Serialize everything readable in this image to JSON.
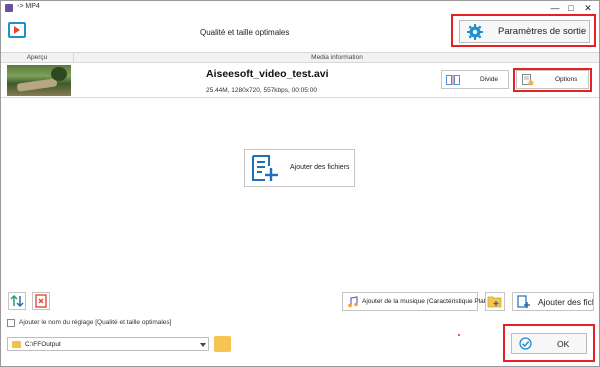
{
  "window": {
    "title": "-> MP4",
    "minimize": "—",
    "maximize": "□",
    "close": "✕"
  },
  "header": {
    "title": "Qualité et taille optimales",
    "params_button": "Paramètres de sortie",
    "app_icon": "video-converter-icon",
    "params_icon": "gear-icon"
  },
  "table": {
    "col_preview": "Aperçu",
    "col_media": "Media information",
    "rows": [
      {
        "filename": "Aiseesoft_video_test.avi",
        "info": "25.44M, 1280x720, 557kbps, 00:05:00",
        "divide_label": "Divide",
        "options_label": "Options"
      }
    ]
  },
  "main": {
    "add_files_label": "Ajouter des fichiers",
    "add_files_icon": "add-file-icon"
  },
  "toolbar": {
    "sort_icon": "sort-icon",
    "delete_icon": "delete-icon",
    "music_label": "Ajouter de la musique (Caractéristique Platine)",
    "music_icon": "music-icon",
    "folder_add_icon": "folder-add-icon",
    "add_files_label": "Ajouter des fichiers"
  },
  "options": {
    "checkbox_label": "Ajouter le nom du réglage [Qualité et taille optimales]",
    "checkbox_checked": false
  },
  "output": {
    "path": "C:\\FFOutput",
    "ok_label": "OK"
  },
  "colors": {
    "accent_blue": "#1e8fd0",
    "highlight_red": "#e52222",
    "folder_yellow": "#f5c451"
  }
}
